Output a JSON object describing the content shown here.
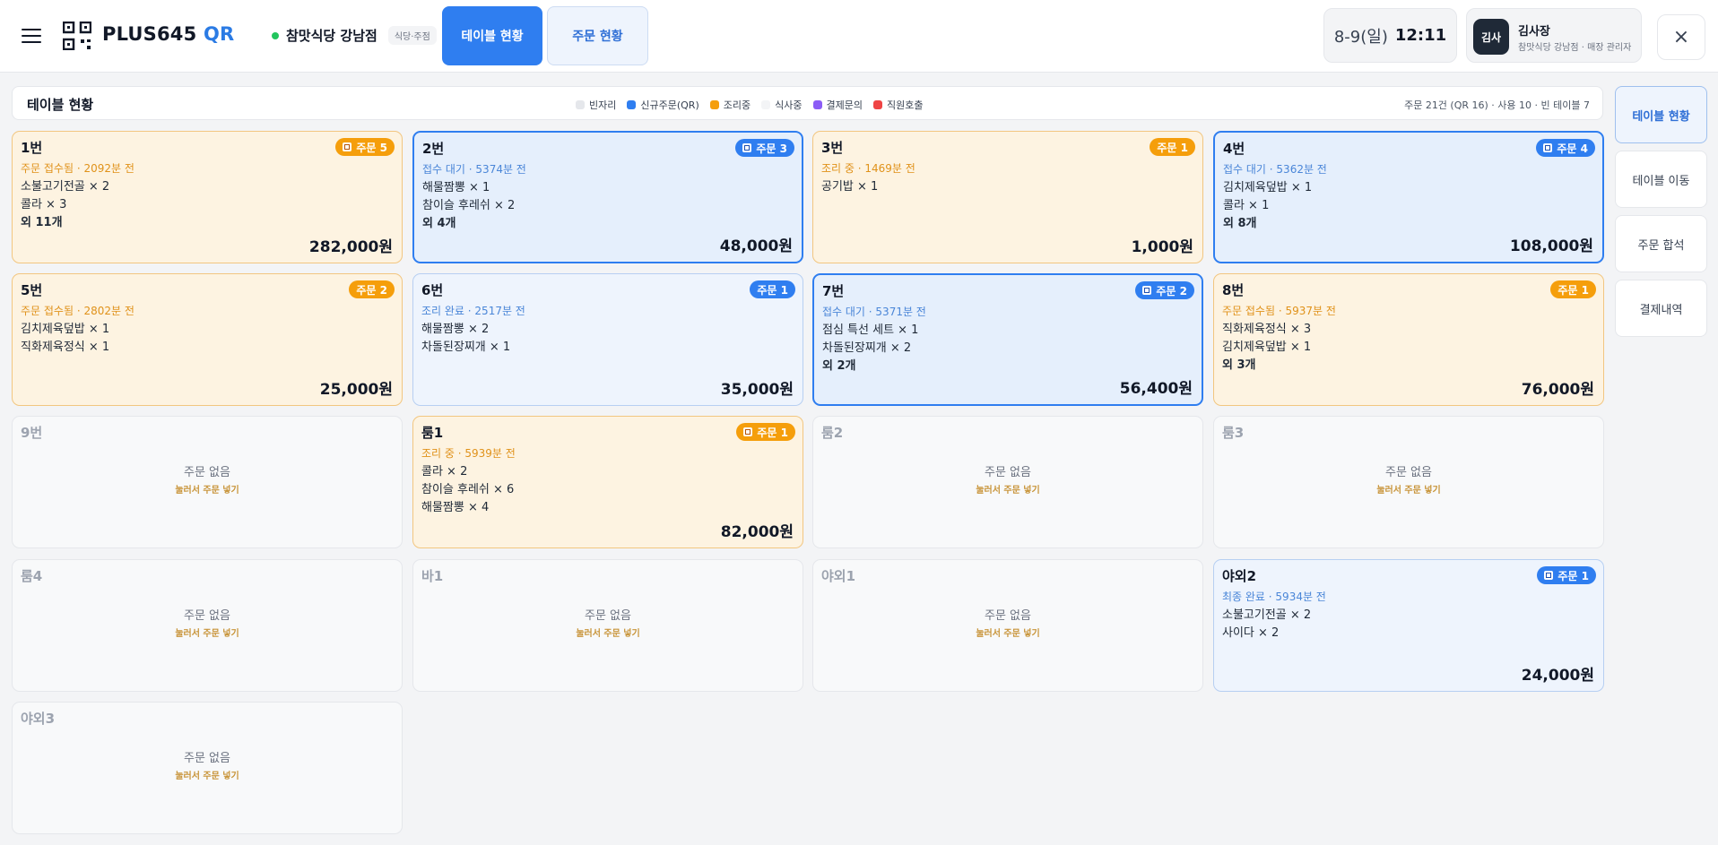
{
  "header": {
    "logo_main": "PLUS645",
    "logo_accent": "QR",
    "store_name": "참맛식당 강남점",
    "store_badge": "식당·주점",
    "tabs": [
      {
        "label": "테이블 현황",
        "active": true
      },
      {
        "label": "주문 현황",
        "active": false
      }
    ],
    "date": "8-9(일)",
    "time": "12:11",
    "user": {
      "avatar": "김사",
      "name": "김사장",
      "role": "참맛식당 강남점 · 매장 관리자"
    },
    "close_icon": "×"
  },
  "status_bar": {
    "title": "테이블 현황",
    "legend": [
      {
        "label": "빈자리",
        "color": "#e5e7eb"
      },
      {
        "label": "신규주문(QR)",
        "color": "#2f7ef0"
      },
      {
        "label": "조리중",
        "color": "#f59e0b"
      },
      {
        "label": "식사중",
        "color": "#f3f4f6"
      },
      {
        "label": "결제문의",
        "color": "#8b5cf6"
      },
      {
        "label": "직원호출",
        "color": "#ef4444"
      }
    ],
    "summary": "주문 21건 (QR 16) · 사용 10 · 빈 테이블 7"
  },
  "side_nav": [
    {
      "label": "테이블 현황",
      "active": true
    },
    {
      "label": "테이블 이동",
      "active": false
    },
    {
      "label": "주문 합석",
      "active": false
    },
    {
      "label": "결제내역",
      "active": false
    }
  ],
  "empty_text": {
    "message": "주문 없음",
    "hint": "눌러서 주문 넣기"
  },
  "tables": [
    {
      "name": "1번",
      "state": "cooking",
      "badge": "주문 5",
      "badge_color": "orange",
      "qr": true,
      "status": "주문 접수됨 · 2092분 전",
      "items": [
        "소불고기전골 × 2",
        "콜라 × 3"
      ],
      "more": "외 11개",
      "total": "282,000원"
    },
    {
      "name": "2번",
      "state": "waiting",
      "badge": "주문 3",
      "badge_color": "blue",
      "qr": true,
      "status": "접수 대기 · 5374분 전",
      "items": [
        "해물짬뽕 × 1",
        "참이슬 후레쉬 × 2"
      ],
      "more": "외 4개",
      "total": "48,000원"
    },
    {
      "name": "3번",
      "state": "cooking",
      "badge": "주문 1",
      "badge_color": "orange",
      "qr": false,
      "status": "조리 중 · 1469분 전",
      "items": [
        "공기밥 × 1"
      ],
      "more": "",
      "total": "1,000원"
    },
    {
      "name": "4번",
      "state": "waiting",
      "badge": "주문 4",
      "badge_color": "blue",
      "qr": true,
      "status": "접수 대기 · 5362분 전",
      "items": [
        "김치제육덮밥 × 1",
        "콜라 × 1"
      ],
      "more": "외 8개",
      "total": "108,000원"
    },
    {
      "name": "5번",
      "state": "cooking",
      "badge": "주문 2",
      "badge_color": "orange",
      "qr": false,
      "status": "주문 접수됨 · 2802분 전",
      "items": [
        "김치제육덮밥 × 1",
        "직화제육정식 × 1"
      ],
      "more": "",
      "total": "25,000원"
    },
    {
      "name": "6번",
      "state": "done",
      "badge": "주문 1",
      "badge_color": "blue",
      "qr": false,
      "status": "조리 완료 · 2517분 전",
      "items": [
        "해물짬뽕 × 2",
        "차돌된장찌개 × 1"
      ],
      "more": "",
      "total": "35,000원"
    },
    {
      "name": "7번",
      "state": "waiting",
      "badge": "주문 2",
      "badge_color": "blue",
      "qr": true,
      "status": "접수 대기 · 5371분 전",
      "items": [
        "점심 특선 세트 × 1",
        "차돌된장찌개 × 2"
      ],
      "more": "외 2개",
      "total": "56,400원"
    },
    {
      "name": "8번",
      "state": "cooking",
      "badge": "주문 1",
      "badge_color": "orange",
      "qr": false,
      "status": "주문 접수됨 · 5937분 전",
      "items": [
        "직화제육정식 × 3",
        "김치제육덮밥 × 1"
      ],
      "more": "외 3개",
      "total": "76,000원"
    },
    {
      "name": "9번",
      "state": "empty"
    },
    {
      "name": "룸1",
      "state": "cooking",
      "badge": "주문 1",
      "badge_color": "orange",
      "qr": true,
      "status": "조리 중 · 5939분 전",
      "items": [
        "콜라 × 2",
        "참이슬 후레쉬 × 6",
        "해물짬뽕 × 4"
      ],
      "more": "",
      "total": "82,000원"
    },
    {
      "name": "룸2",
      "state": "empty"
    },
    {
      "name": "룸3",
      "state": "empty"
    },
    {
      "name": "룸4",
      "state": "empty"
    },
    {
      "name": "바1",
      "state": "empty"
    },
    {
      "name": "야외1",
      "state": "empty"
    },
    {
      "name": "야외2",
      "state": "done",
      "badge": "주문 1",
      "badge_color": "blue",
      "qr": true,
      "status": "최종 완료 · 5934분 전",
      "items": [
        "소불고기전골 × 2",
        "사이다 × 2"
      ],
      "more": "",
      "total": "24,000원"
    },
    {
      "name": "야외3",
      "state": "empty"
    }
  ]
}
